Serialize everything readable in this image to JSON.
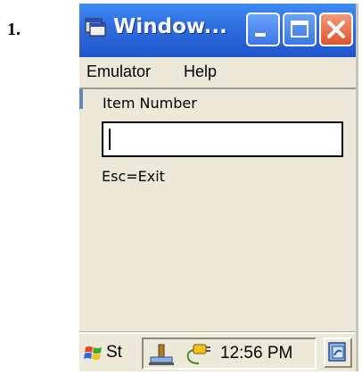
{
  "step": {
    "number": "1."
  },
  "window": {
    "title": "Window...",
    "icon": "app-window-icon",
    "controls": [
      "minimize-icon",
      "maximize-icon",
      "close-icon"
    ]
  },
  "menu": {
    "items": [
      "Emulator",
      "Help"
    ]
  },
  "form": {
    "label": "Item Number",
    "input_value": "",
    "hint": "Esc=Exit"
  },
  "taskbar": {
    "start_label": "St",
    "clock": "12:56 PM",
    "tray_icons": [
      "usb-icon",
      "power-plug-icon"
    ],
    "switcher_icon": "task-switcher-icon"
  },
  "colors": {
    "titlebar": "#2f6fe0",
    "close_button": "#e0532a",
    "chrome": "#ece9d8"
  }
}
